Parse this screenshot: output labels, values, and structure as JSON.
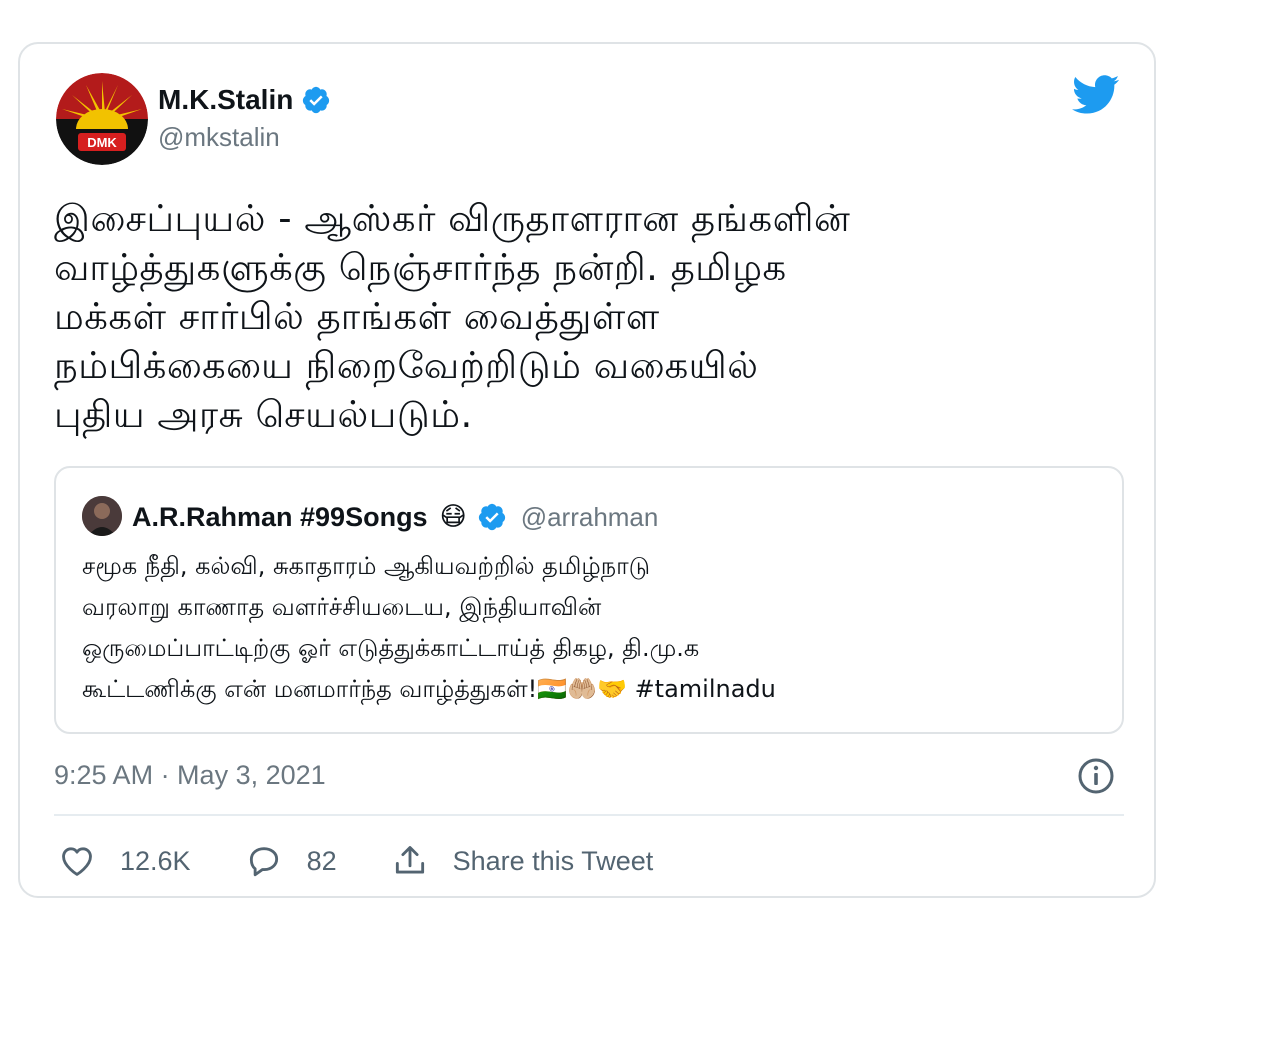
{
  "tweet": {
    "author_name": "M.K.Stalin",
    "author_handle": "@mkstalin",
    "avatar_text": "DMK",
    "text": "இசைப்புயல் - ஆஸ்கர் விருதாளரான தங்களின்\nவாழ்த்துகளுக்கு நெஞ்சார்ந்த நன்றி.  தமிழக\nமக்கள் சார்பில் தாங்கள் வைத்துள்ள\nநம்பிக்கையை நிறைவேற்றிடும் வகையில்\nபுதிய அரசு செயல்படும்.",
    "timestamp": "9:25 AM · May 3, 2021",
    "like_count": "12.6K",
    "reply_count": "82",
    "share_label": "Share this Tweet",
    "colors": {
      "verified": "#1d9bf0",
      "twitter_bird": "#1d9bf0",
      "secondary_text": "#6b7780"
    }
  },
  "quoted_tweet": {
    "author_name": "A.R.Rahman #99Songs",
    "emoji": "😷",
    "author_handle": "@arrahman",
    "text": "சமூக நீதி, கல்வி, சுகாதாரம் ஆகியவற்றில் தமிழ்நாடு\nவரலாறு காணாத வளர்ச்சியடைய, இந்தியாவின்\nஒருமைப்பாட்டிற்கு ஓர் எடுத்துக்காட்டாய்த் திகழ, தி.மு.க\nகூட்டணிக்கு என் மனமார்ந்த வாழ்த்துகள்!🇮🇳🤲🏼🤝 #tamilnadu"
  },
  "icons": {
    "bird": "twitter-bird-icon",
    "verified": "verified-badge-icon",
    "info": "info-icon",
    "like": "heart-icon",
    "reply": "reply-bubble-icon",
    "share": "share-upload-icon"
  }
}
